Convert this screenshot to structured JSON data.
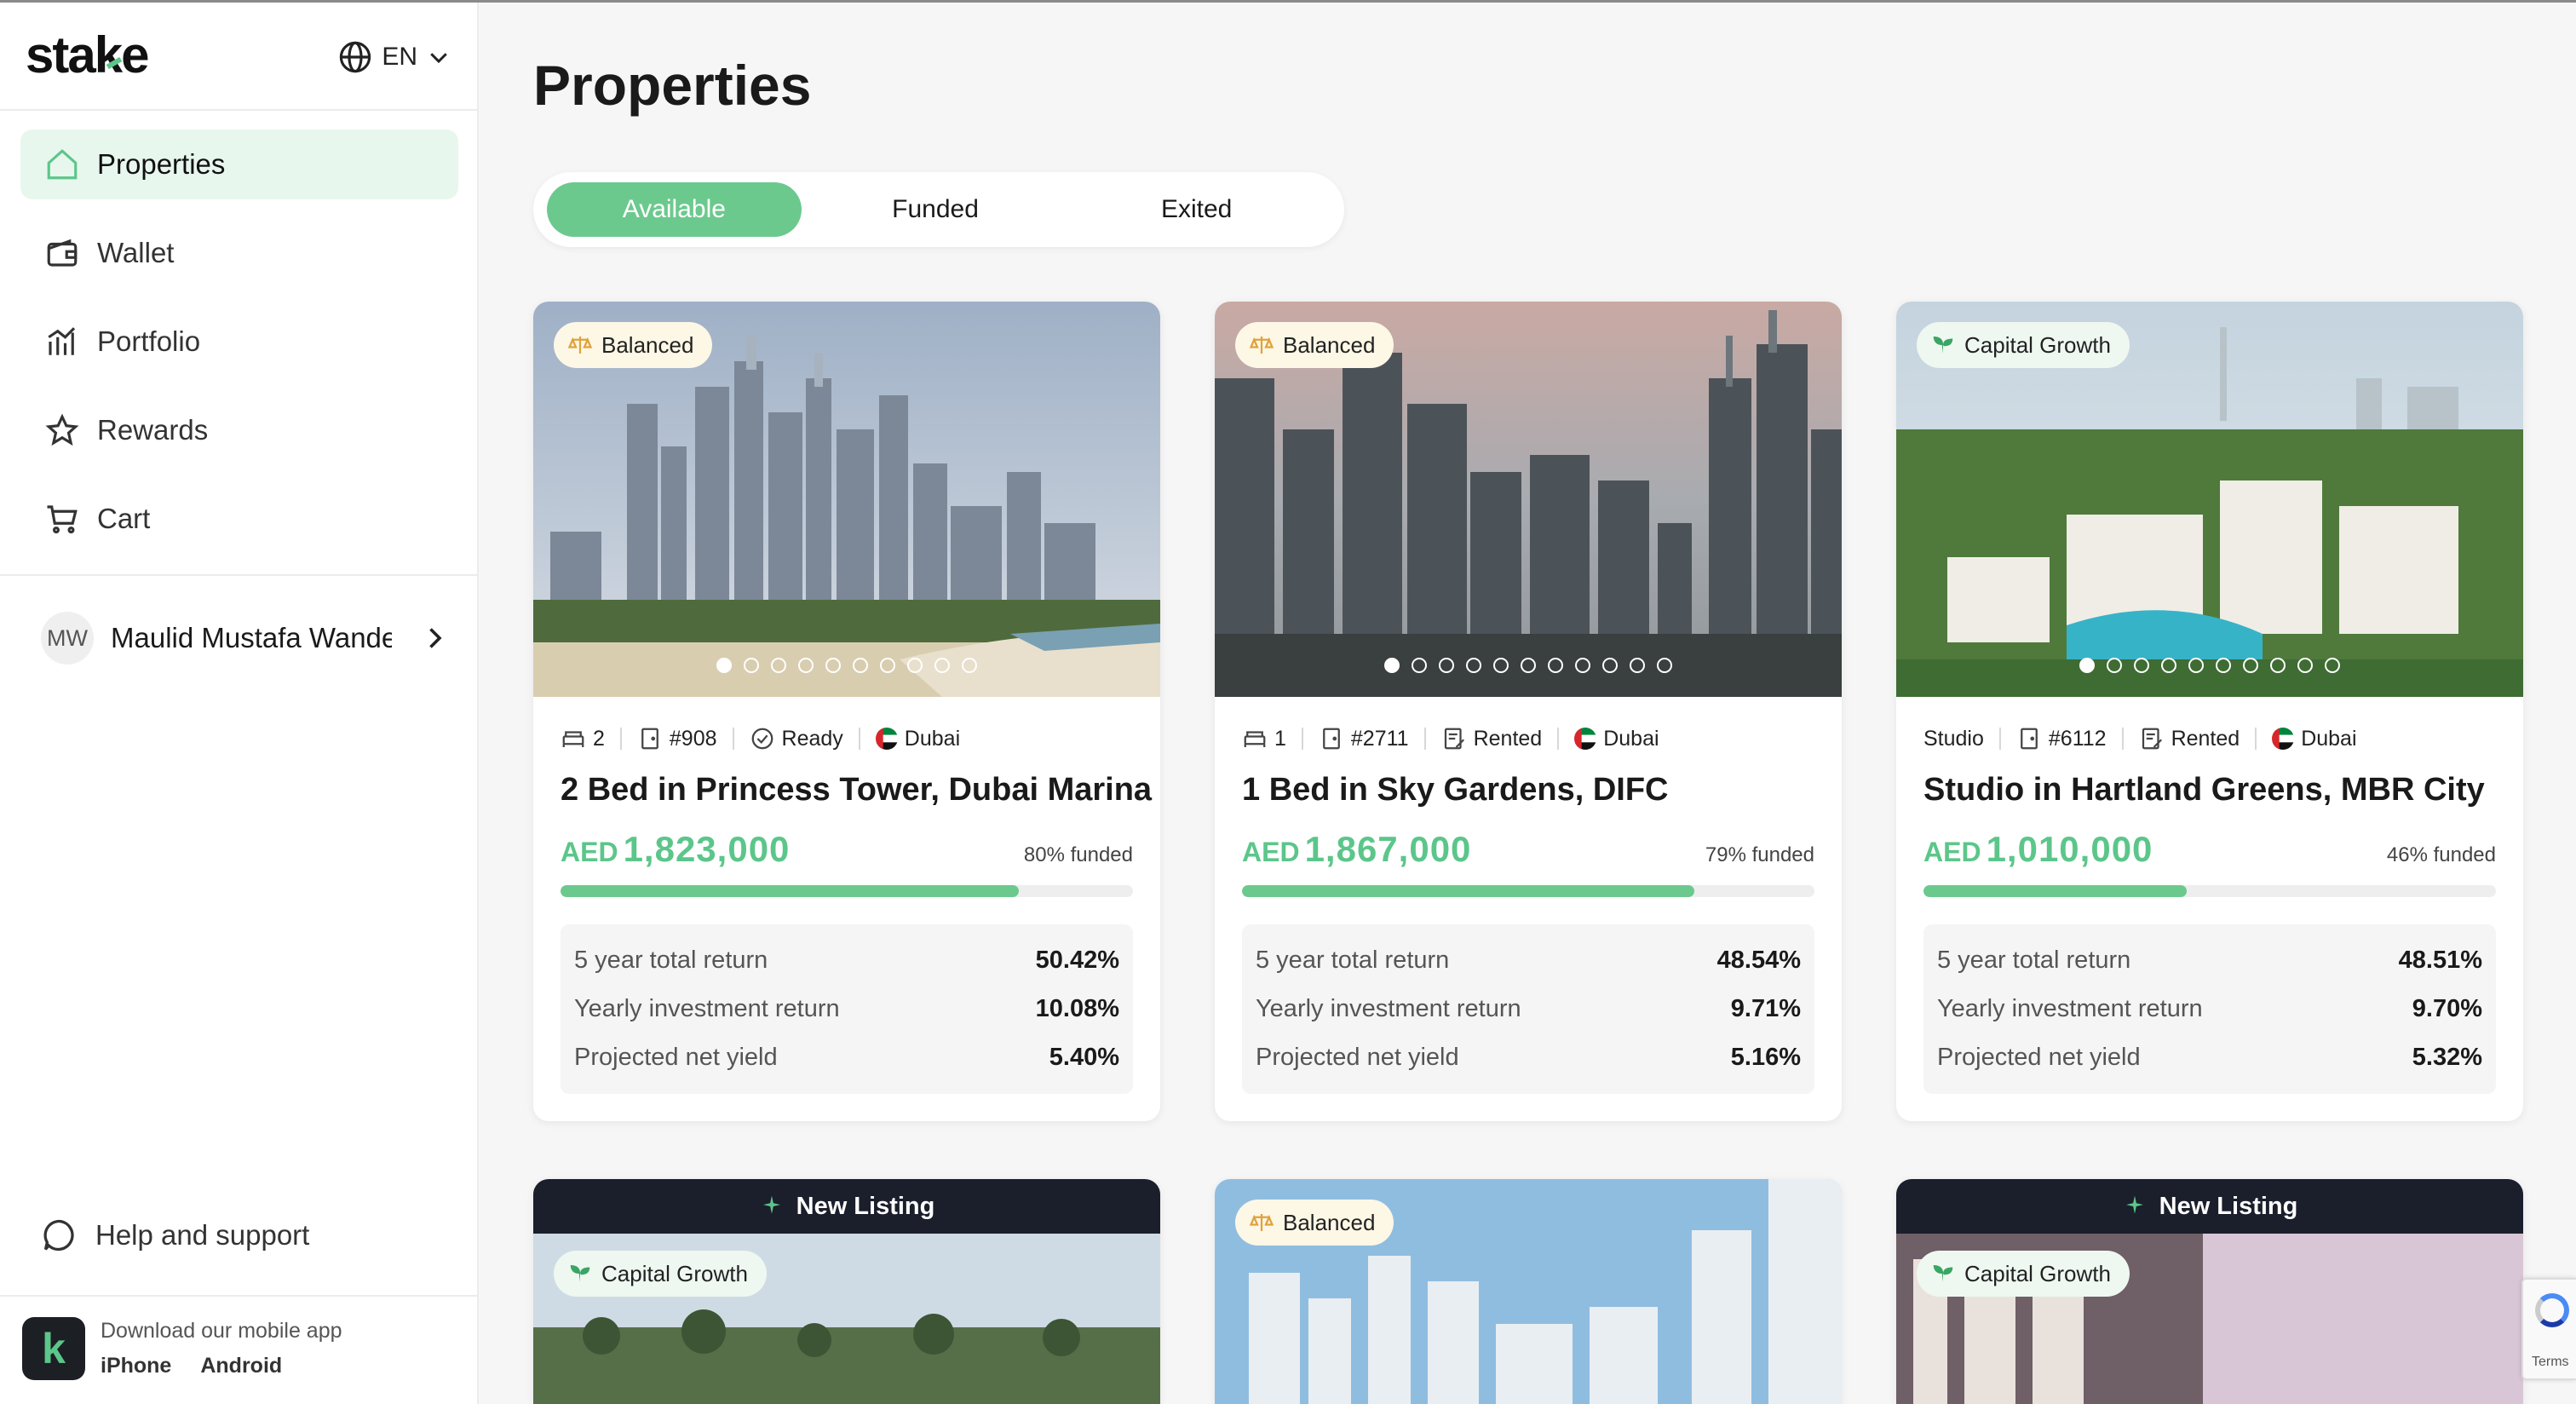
{
  "brand": {
    "logo_text": "stake",
    "accent": "#5cc68a"
  },
  "language": {
    "label": "EN",
    "icon": "globe-icon"
  },
  "sidebar": {
    "items": [
      {
        "label": "Properties",
        "icon": "home-icon",
        "active": true
      },
      {
        "label": "Wallet",
        "icon": "wallet-icon",
        "active": false
      },
      {
        "label": "Portfolio",
        "icon": "portfolio-icon",
        "active": false
      },
      {
        "label": "Rewards",
        "icon": "star-icon",
        "active": false
      },
      {
        "label": "Cart",
        "icon": "cart-icon",
        "active": false
      }
    ],
    "user": {
      "initials": "MW",
      "name": "Maulid Mustafa Wandera"
    },
    "help_label": "Help and support",
    "app_promo": {
      "title": "Download our mobile app",
      "iphone": "iPhone",
      "android": "Android",
      "icon_letter": "k"
    }
  },
  "main": {
    "title": "Properties",
    "tabs": [
      {
        "label": "Available",
        "active": true
      },
      {
        "label": "Funded",
        "active": false
      },
      {
        "label": "Exited",
        "active": false
      }
    ],
    "cards": [
      {
        "badge": "Balanced",
        "badge_type": "balanced",
        "beds": "2",
        "ref": "#908",
        "status": "Ready",
        "city": "Dubai",
        "title": "2 Bed in Princess Tower, Dubai Marina",
        "currency": "AED",
        "price": "1,823,000",
        "funded": "80% funded",
        "funded_pct": 80,
        "stats": [
          {
            "label": "5 year total return",
            "value": "50.42%"
          },
          {
            "label": "Yearly investment return",
            "value": "10.08%"
          },
          {
            "label": "Projected net yield",
            "value": "5.40%"
          }
        ]
      },
      {
        "badge": "Balanced",
        "badge_type": "balanced",
        "beds": "1",
        "ref": "#2711",
        "status": "Rented",
        "city": "Dubai",
        "title": "1 Bed in Sky Gardens, DIFC",
        "currency": "AED",
        "price": "1,867,000",
        "funded": "79% funded",
        "funded_pct": 79,
        "stats": [
          {
            "label": "5 year total return",
            "value": "48.54%"
          },
          {
            "label": "Yearly investment return",
            "value": "9.71%"
          },
          {
            "label": "Projected net yield",
            "value": "5.16%"
          }
        ]
      },
      {
        "badge": "Capital Growth",
        "badge_type": "growth",
        "beds": "Studio",
        "ref": "#6112",
        "status": "Rented",
        "city": "Dubai",
        "title": "Studio in Hartland Greens, MBR City",
        "currency": "AED",
        "price": "1,010,000",
        "funded": "46% funded",
        "funded_pct": 46,
        "stats": [
          {
            "label": "5 year total return",
            "value": "48.51%"
          },
          {
            "label": "Yearly investment return",
            "value": "9.70%"
          },
          {
            "label": "Projected net yield",
            "value": "5.32%"
          }
        ]
      }
    ],
    "row2": [
      {
        "new_listing": "New Listing",
        "badge": "Capital Growth"
      },
      {
        "badge": "Balanced"
      },
      {
        "new_listing": "New Listing",
        "badge": "Capital Growth"
      }
    ]
  },
  "recaptcha": {
    "terms": "Terms"
  }
}
